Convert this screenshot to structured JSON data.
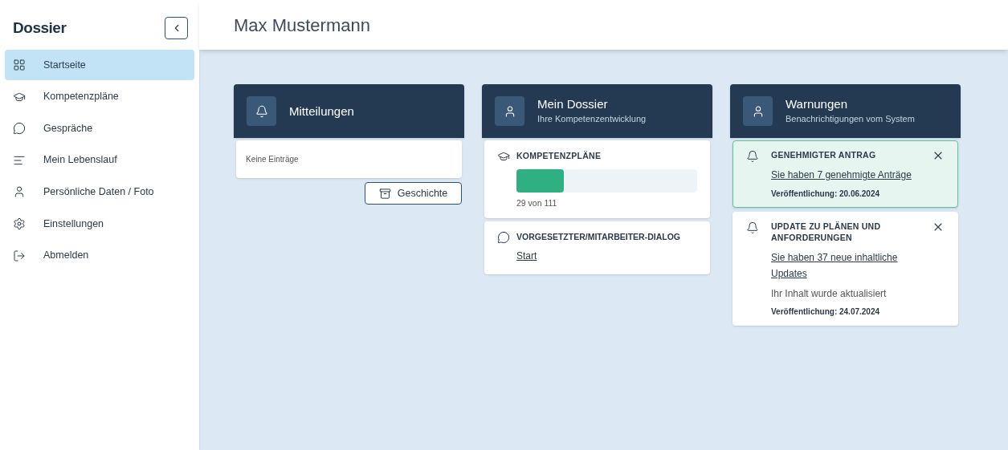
{
  "logo": "Dossier",
  "sidebar": {
    "items": [
      {
        "label": "Startseite",
        "kind": "grid",
        "selected": true
      },
      {
        "label": "Kompetenzpläne",
        "kind": "cap",
        "selected": false
      },
      {
        "label": "Gespräche",
        "kind": "chat",
        "selected": false
      },
      {
        "label": "Mein Lebenslauf",
        "kind": "lines",
        "selected": false
      },
      {
        "label": "Persönliche Daten / Foto",
        "kind": "user",
        "selected": false
      },
      {
        "label": "Einstellungen",
        "kind": "gear",
        "selected": false
      },
      {
        "label": "Abmelden",
        "kind": "logout",
        "selected": false
      }
    ]
  },
  "header": {
    "title": "Max Mustermann"
  },
  "mitteilungen": {
    "title": "Mitteilungen",
    "empty": "Keine Einträge",
    "button": "Geschichte"
  },
  "dossier": {
    "title": "Mein Dossier",
    "subtitle": "Ihre Kompetenzentwicklung",
    "plans": {
      "title": "KOMPETENZPLÄNE",
      "level": 0.26,
      "reading": "29 von 111"
    },
    "dialog": {
      "title": "VORGESETZTER/MITARBEITER-DIALOG",
      "link": "Start"
    }
  },
  "warnungen": {
    "title": "Warnungen",
    "subtitle": "Benachrichtigungen vom System",
    "items": [
      {
        "title": "GENEHMIGTER ANTRAG",
        "link": "Sie haben 7 genehmigte Anträge",
        "date": "Veröffentlichung: 20.06.2024",
        "highlighted": true
      },
      {
        "title": "UPDATE ZU PLÄNEN UND ANFORDERUNGEN",
        "link": "Sie haben 37 neue inhaltliche Updates",
        "text": "Ihr Inhalt wurde aktualisiert",
        "date": "Veröffentlichung: 24.07.2024",
        "highlighted": false
      }
    ]
  }
}
